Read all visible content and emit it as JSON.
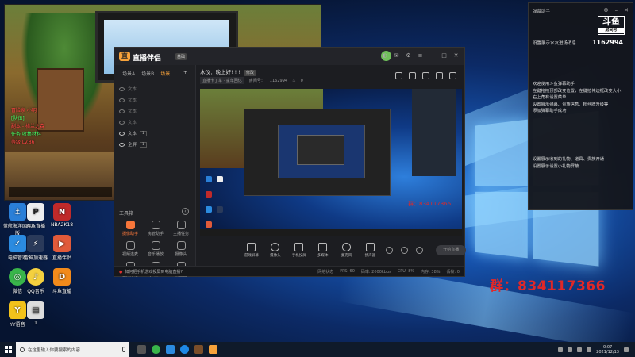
{
  "desktop": {
    "icons": [
      {
        "label": "蓝航海洋国际版"
      },
      {
        "label": "电脑管家"
      },
      {
        "label": "微信"
      },
      {
        "label": "YY语音"
      },
      {
        "label": "斗鱼直播"
      },
      {
        "label": "雷神加速器"
      },
      {
        "label": "QQ音乐"
      },
      {
        "label": "1"
      },
      {
        "label": "NBA2K18"
      },
      {
        "label": "直播伴侣"
      },
      {
        "label": "斗鱼直播"
      }
    ],
    "qq_overlay": "群：834117366"
  },
  "app": {
    "name": "直播伴侣",
    "badge": "基础",
    "scene_tabs": [
      "场景A",
      "场景B",
      "场景"
    ],
    "active_scene_index": 2,
    "sources": [
      {
        "name": "文本",
        "on": false
      },
      {
        "name": "文本",
        "on": false
      },
      {
        "name": "文本",
        "on": false
      },
      {
        "name": "文本",
        "on": false
      },
      {
        "name": "文本",
        "on": true,
        "tag": "1"
      },
      {
        "name": "全屏",
        "on": true,
        "tag": "1"
      }
    ],
    "toolbox_title": "工具箱",
    "tools": [
      {
        "label": "摄像助手",
        "active": true
      },
      {
        "label": "房管助手",
        "active": false
      },
      {
        "label": "主播任务",
        "active": false
      },
      {
        "label": "视频连麦",
        "active": false
      },
      {
        "label": "音乐播放",
        "active": false
      },
      {
        "label": "摄像头",
        "active": false
      },
      {
        "label": "虚拟形象",
        "active": false
      },
      {
        "label": "弹幕库",
        "active": false
      },
      {
        "label": "粉丝团",
        "active": false
      },
      {
        "label": "直播回放",
        "active": false
      },
      {
        "label": "",
        "active": false
      },
      {
        "label": "",
        "active": false
      }
    ],
    "stream_title": "水仪：晚上好! ! !",
    "stream_title_tag": "修改",
    "stream_room_name": "直播卡丁车 · 童年回忆",
    "stream_room_label": "房间号：",
    "stream_room_id": "1162994",
    "stream_viewers": "0",
    "bottom_controls": [
      {
        "label": "游戏屏幕"
      },
      {
        "label": "摄像头"
      },
      {
        "label": "手机投屏"
      },
      {
        "label": "多媒体"
      },
      {
        "label": "麦克风"
      },
      {
        "label": "扬声器"
      }
    ],
    "live_button": "开始直播",
    "status_hint": "如何把手机游戏投屏到电脑直播?",
    "status_stats": [
      "网络状态",
      "FPS: 60",
      "码率: 2000kbps",
      "CPU: 8%",
      "内存: 38%",
      "丢帧: 0"
    ],
    "preview_qq": "群：834117366"
  },
  "right_panel": {
    "title": "弹幕助手",
    "logo_top": "斗鱼",
    "logo_bottom": "房间号",
    "room_number": "1162994",
    "line1": "设置展示水友进场消息",
    "desc": "欢迎使用斗鱼弹幕助手\n左键拖拽顶部改变位置，左键拉伸边框改变大小\n右上角有设置菜单\n设置展示弹幕、贵族信息、粉丝牌升级等\n添加弹幕助手成功",
    "desc2": "设置展示收到的礼物、道具、贵族开通\n设置展示设置小礼物屏蔽"
  },
  "taskbar": {
    "search_placeholder": "在这里输入你要搜索的内容",
    "time": "0:07",
    "date": "2021/12/13"
  },
  "game": {
    "hud_lines": [
      "冒险家 小明",
      "[队伍]",
      "副本 - 格兰之森",
      "任务 收集材料",
      "等级 LV.86"
    ]
  },
  "colors": {
    "accent": "#f7a23a",
    "qq_red": "#e02828",
    "app_bg": "#1c1d21"
  }
}
